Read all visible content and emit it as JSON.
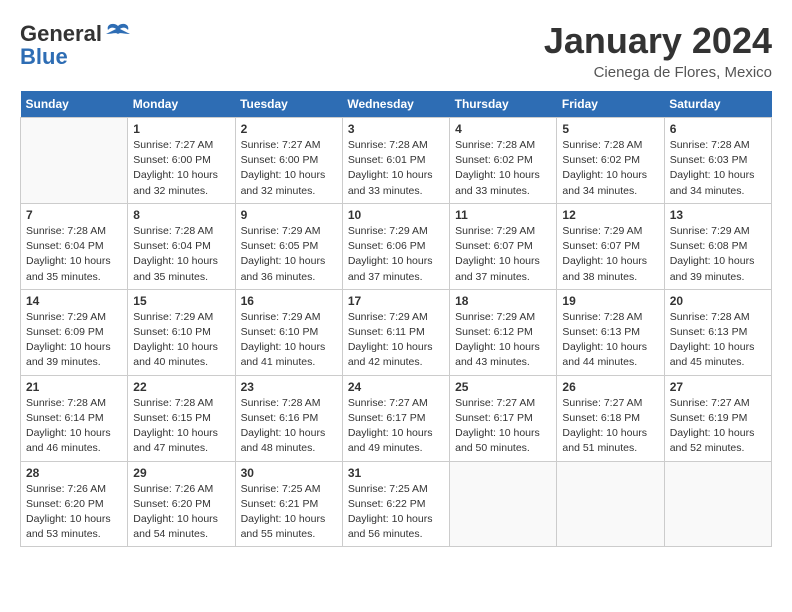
{
  "logo": {
    "line1": "General",
    "line2": "Blue"
  },
  "title": "January 2024",
  "location": "Cienega de Flores, Mexico",
  "days_header": [
    "Sunday",
    "Monday",
    "Tuesday",
    "Wednesday",
    "Thursday",
    "Friday",
    "Saturday"
  ],
  "weeks": [
    [
      {
        "day": "",
        "info": ""
      },
      {
        "day": "1",
        "info": "Sunrise: 7:27 AM\nSunset: 6:00 PM\nDaylight: 10 hours\nand 32 minutes."
      },
      {
        "day": "2",
        "info": "Sunrise: 7:27 AM\nSunset: 6:00 PM\nDaylight: 10 hours\nand 32 minutes."
      },
      {
        "day": "3",
        "info": "Sunrise: 7:28 AM\nSunset: 6:01 PM\nDaylight: 10 hours\nand 33 minutes."
      },
      {
        "day": "4",
        "info": "Sunrise: 7:28 AM\nSunset: 6:02 PM\nDaylight: 10 hours\nand 33 minutes."
      },
      {
        "day": "5",
        "info": "Sunrise: 7:28 AM\nSunset: 6:02 PM\nDaylight: 10 hours\nand 34 minutes."
      },
      {
        "day": "6",
        "info": "Sunrise: 7:28 AM\nSunset: 6:03 PM\nDaylight: 10 hours\nand 34 minutes."
      }
    ],
    [
      {
        "day": "7",
        "info": "Sunrise: 7:28 AM\nSunset: 6:04 PM\nDaylight: 10 hours\nand 35 minutes."
      },
      {
        "day": "8",
        "info": "Sunrise: 7:28 AM\nSunset: 6:04 PM\nDaylight: 10 hours\nand 35 minutes."
      },
      {
        "day": "9",
        "info": "Sunrise: 7:29 AM\nSunset: 6:05 PM\nDaylight: 10 hours\nand 36 minutes."
      },
      {
        "day": "10",
        "info": "Sunrise: 7:29 AM\nSunset: 6:06 PM\nDaylight: 10 hours\nand 37 minutes."
      },
      {
        "day": "11",
        "info": "Sunrise: 7:29 AM\nSunset: 6:07 PM\nDaylight: 10 hours\nand 37 minutes."
      },
      {
        "day": "12",
        "info": "Sunrise: 7:29 AM\nSunset: 6:07 PM\nDaylight: 10 hours\nand 38 minutes."
      },
      {
        "day": "13",
        "info": "Sunrise: 7:29 AM\nSunset: 6:08 PM\nDaylight: 10 hours\nand 39 minutes."
      }
    ],
    [
      {
        "day": "14",
        "info": "Sunrise: 7:29 AM\nSunset: 6:09 PM\nDaylight: 10 hours\nand 39 minutes."
      },
      {
        "day": "15",
        "info": "Sunrise: 7:29 AM\nSunset: 6:10 PM\nDaylight: 10 hours\nand 40 minutes."
      },
      {
        "day": "16",
        "info": "Sunrise: 7:29 AM\nSunset: 6:10 PM\nDaylight: 10 hours\nand 41 minutes."
      },
      {
        "day": "17",
        "info": "Sunrise: 7:29 AM\nSunset: 6:11 PM\nDaylight: 10 hours\nand 42 minutes."
      },
      {
        "day": "18",
        "info": "Sunrise: 7:29 AM\nSunset: 6:12 PM\nDaylight: 10 hours\nand 43 minutes."
      },
      {
        "day": "19",
        "info": "Sunrise: 7:28 AM\nSunset: 6:13 PM\nDaylight: 10 hours\nand 44 minutes."
      },
      {
        "day": "20",
        "info": "Sunrise: 7:28 AM\nSunset: 6:13 PM\nDaylight: 10 hours\nand 45 minutes."
      }
    ],
    [
      {
        "day": "21",
        "info": "Sunrise: 7:28 AM\nSunset: 6:14 PM\nDaylight: 10 hours\nand 46 minutes."
      },
      {
        "day": "22",
        "info": "Sunrise: 7:28 AM\nSunset: 6:15 PM\nDaylight: 10 hours\nand 47 minutes."
      },
      {
        "day": "23",
        "info": "Sunrise: 7:28 AM\nSunset: 6:16 PM\nDaylight: 10 hours\nand 48 minutes."
      },
      {
        "day": "24",
        "info": "Sunrise: 7:27 AM\nSunset: 6:17 PM\nDaylight: 10 hours\nand 49 minutes."
      },
      {
        "day": "25",
        "info": "Sunrise: 7:27 AM\nSunset: 6:17 PM\nDaylight: 10 hours\nand 50 minutes."
      },
      {
        "day": "26",
        "info": "Sunrise: 7:27 AM\nSunset: 6:18 PM\nDaylight: 10 hours\nand 51 minutes."
      },
      {
        "day": "27",
        "info": "Sunrise: 7:27 AM\nSunset: 6:19 PM\nDaylight: 10 hours\nand 52 minutes."
      }
    ],
    [
      {
        "day": "28",
        "info": "Sunrise: 7:26 AM\nSunset: 6:20 PM\nDaylight: 10 hours\nand 53 minutes."
      },
      {
        "day": "29",
        "info": "Sunrise: 7:26 AM\nSunset: 6:20 PM\nDaylight: 10 hours\nand 54 minutes."
      },
      {
        "day": "30",
        "info": "Sunrise: 7:25 AM\nSunset: 6:21 PM\nDaylight: 10 hours\nand 55 minutes."
      },
      {
        "day": "31",
        "info": "Sunrise: 7:25 AM\nSunset: 6:22 PM\nDaylight: 10 hours\nand 56 minutes."
      },
      {
        "day": "",
        "info": ""
      },
      {
        "day": "",
        "info": ""
      },
      {
        "day": "",
        "info": ""
      }
    ]
  ]
}
